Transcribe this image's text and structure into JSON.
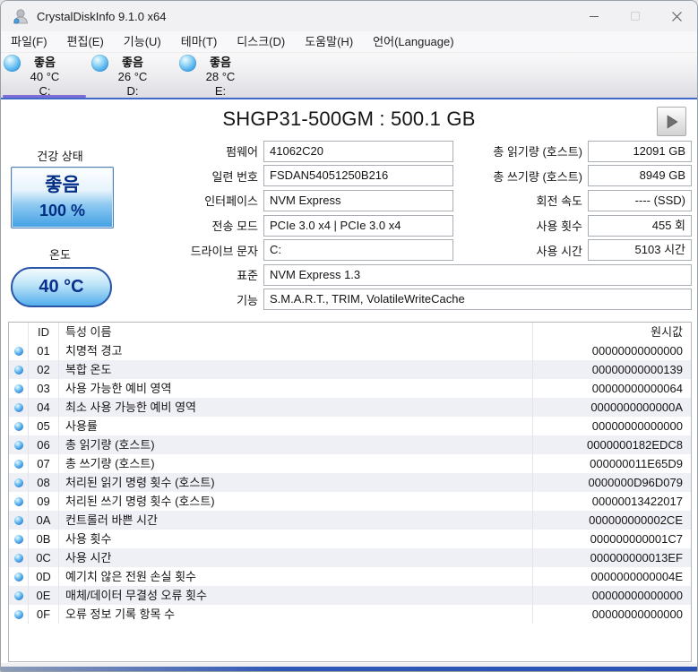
{
  "window": {
    "title": "CrystalDiskInfo 9.1.0 x64"
  },
  "menu": {
    "file": "파일(F)",
    "edit": "편집(E)",
    "function": "기능(U)",
    "theme": "테마(T)",
    "disk": "디스크(D)",
    "help": "도움말(H)",
    "language": "언어(Language)"
  },
  "drive_tabs": [
    {
      "status": "좋음",
      "temp": "40 °C",
      "letter": "C:",
      "selected": true
    },
    {
      "status": "좋음",
      "temp": "26 °C",
      "letter": "D:",
      "selected": false
    },
    {
      "status": "좋음",
      "temp": "28 °C",
      "letter": "E:",
      "selected": false
    }
  ],
  "drive": {
    "title": "SHGP31-500GM : 500.1 GB",
    "health": {
      "label": "건강 상태",
      "status": "좋음",
      "percent": "100 %"
    },
    "temperature": {
      "label": "온도",
      "value": "40 °C"
    },
    "firmware": {
      "label": "펌웨어",
      "value": "41062C20"
    },
    "serial": {
      "label": "일련 번호",
      "value": "FSDAN54051250B216"
    },
    "interface": {
      "label": "인터페이스",
      "value": "NVM Express"
    },
    "transfer_mode": {
      "label": "전송 모드",
      "value": "PCIe 3.0 x4 | PCIe 3.0 x4"
    },
    "drive_letter": {
      "label": "드라이브 문자",
      "value": "C:"
    },
    "standard": {
      "label": "표준",
      "value": "NVM Express 1.3"
    },
    "features": {
      "label": "기능",
      "value": "S.M.A.R.T., TRIM, VolatileWriteCache"
    },
    "host_reads": {
      "label": "총 읽기량 (호스트)",
      "value": "12091 GB"
    },
    "host_writes": {
      "label": "총 쓰기량 (호스트)",
      "value": "8949 GB"
    },
    "rotation_rate": {
      "label": "회전 속도",
      "value": "---- (SSD)"
    },
    "power_on_count": {
      "label": "사용 횟수",
      "value": "455 회"
    },
    "power_on_hours": {
      "label": "사용 시간",
      "value": "5103 시간"
    }
  },
  "smart_table": {
    "headers": {
      "id": "ID",
      "name": "특성 이름",
      "raw": "원시값"
    },
    "rows": [
      {
        "id": "01",
        "name": "치명적 경고",
        "raw": "00000000000000"
      },
      {
        "id": "02",
        "name": "복합 온도",
        "raw": "00000000000139"
      },
      {
        "id": "03",
        "name": "사용 가능한 예비 영역",
        "raw": "00000000000064"
      },
      {
        "id": "04",
        "name": "최소 사용 가능한 예비 영역",
        "raw": "0000000000000A"
      },
      {
        "id": "05",
        "name": "사용률",
        "raw": "00000000000000"
      },
      {
        "id": "06",
        "name": "총 읽기량 (호스트)",
        "raw": "0000000182EDC8"
      },
      {
        "id": "07",
        "name": "총 쓰기량 (호스트)",
        "raw": "000000011E65D9"
      },
      {
        "id": "08",
        "name": "처리된 읽기 명령 횟수 (호스트)",
        "raw": "0000000D96D079"
      },
      {
        "id": "09",
        "name": "처리된 쓰기 명령 횟수 (호스트)",
        "raw": "00000013422017"
      },
      {
        "id": "0A",
        "name": "컨트롤러 바쁜 시간",
        "raw": "000000000002CE"
      },
      {
        "id": "0B",
        "name": "사용 횟수",
        "raw": "000000000001C7"
      },
      {
        "id": "0C",
        "name": "사용 시간",
        "raw": "000000000013EF"
      },
      {
        "id": "0D",
        "name": "예기치 않은 전원 손실 횟수",
        "raw": "0000000000004E"
      },
      {
        "id": "0E",
        "name": "매체/데이터 무결성 오류 횟수",
        "raw": "00000000000000"
      },
      {
        "id": "0F",
        "name": "오류 정보 기록 항목 수",
        "raw": "00000000000000"
      }
    ]
  },
  "colors": {
    "selected_tab_underline": "#7e6bd4",
    "toolbar_accent_line": "#4169cc",
    "health_badge_blue": "#42a0e4",
    "health_text_navy": "#002d85",
    "row_alt": "#efeff6",
    "status_dot_blue": "#2a7fd4"
  }
}
